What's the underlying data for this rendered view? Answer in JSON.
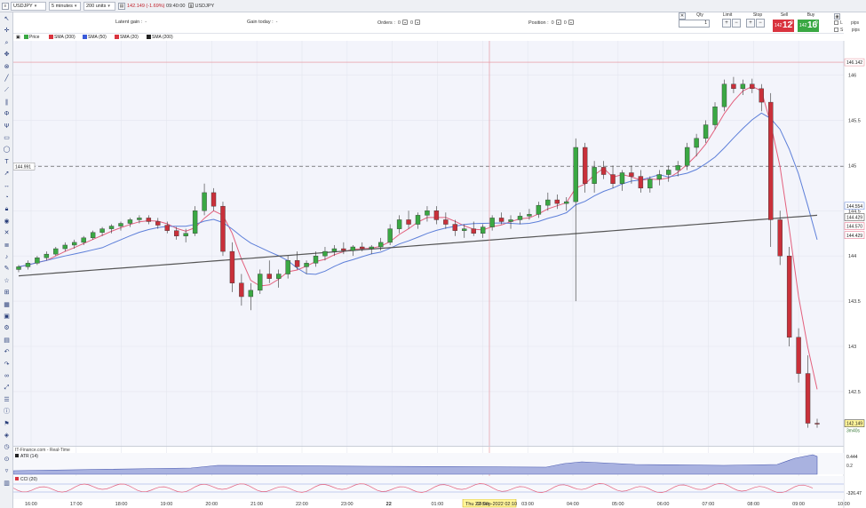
{
  "toolbar": {
    "instrument": "USDJPY",
    "timeframe": "5 minutes",
    "size": "200 units",
    "price_text": "142.149",
    "change_text": "(-1.69%)",
    "time_text": "09:40:00",
    "symbol": "USDJPY"
  },
  "info": {
    "latent_gain_label": "Latent gain :",
    "latent_gain_value": "-",
    "gain_today_label": "Gain today :",
    "gain_today_value": "-",
    "orders_label": "Orders :",
    "orders_value1": "0",
    "orders_value2": "0",
    "position_label": "Position :",
    "position_value1": "0",
    "position_value2": "0"
  },
  "ticket": {
    "qty_label": "Qty",
    "qty_value": "1",
    "limit_label": "Limit",
    "stop_label": "Stop",
    "sell_label": "Sell",
    "buy_label": "Buy",
    "sell_price_small": "142",
    "sell_price_big": "12",
    "sell_price_sup": "9",
    "buy_price_small": "142",
    "buy_price_big": "16",
    "buy_price_sup": "9",
    "pips_label_1": "pips",
    "pips_label_2": "pips",
    "row1_letter": "L",
    "row2_letter": "S"
  },
  "legend": [
    {
      "label": "Price",
      "color": "#3aa843"
    },
    {
      "label": "SMA (200)",
      "color": "#d9343f"
    },
    {
      "label": "SMA (50)",
      "color": "#3a5bd9"
    },
    {
      "label": "SMA (20)",
      "color": "#d9343f"
    },
    {
      "label": "SMA (200)",
      "color": "#222222"
    }
  ],
  "panes": {
    "source_label": "IT-Finance.com - Real-Time",
    "atr_label": "ATR (14)",
    "cci_label": "CCI (20)"
  },
  "colors": {
    "bull": "#3aa843",
    "bear": "#c9303a",
    "sma_pink": "#e3607d",
    "sma_blue": "#5d7fd9",
    "sma_dark": "#555555",
    "grid": "#e4e6ef",
    "bg": "#f3f4fb"
  },
  "chart_data": {
    "type": "candlestick",
    "instrument": "USDJPY",
    "timeframe": "5 minutes",
    "x_labels": [
      "16:00",
      "17:00",
      "18:00",
      "19:00",
      "20:00",
      "21:00",
      "22:00",
      "23:00",
      "22",
      "01:00",
      "02:00",
      "03:00",
      "04:00",
      "05:00",
      "06:00",
      "07:00",
      "08:00",
      "09:00",
      "10:00"
    ],
    "crosshair_label": "Thu 22-Sep-2022 02:10",
    "y_ticks": [
      146,
      145.5,
      145,
      144.5,
      144,
      143.5,
      143,
      142.5
    ],
    "ylim": [
      141.9,
      146.3
    ],
    "price_labels": {
      "top": "146.142",
      "dashed_level": "144.991",
      "sma20": "144.554",
      "sma50": "144.570",
      "sma200a": "144.429",
      "sma200b": "144.429",
      "last": "142.149",
      "countdown": "3m40s"
    },
    "hlines": {
      "top": 146.142,
      "dashed": 144.991
    },
    "ohlc_path": [
      [
        143.85,
        143.9,
        143.82,
        143.88
      ],
      [
        143.88,
        143.95,
        143.85,
        143.92
      ],
      [
        143.92,
        144.0,
        143.9,
        143.98
      ],
      [
        143.98,
        144.05,
        143.95,
        144.02
      ],
      [
        144.02,
        144.1,
        144.0,
        144.08
      ],
      [
        144.08,
        144.15,
        144.05,
        144.12
      ],
      [
        144.12,
        144.18,
        144.08,
        144.15
      ],
      [
        144.15,
        144.22,
        144.12,
        144.2
      ],
      [
        144.2,
        144.28,
        144.18,
        144.26
      ],
      [
        144.26,
        144.32,
        144.22,
        144.3
      ],
      [
        144.3,
        144.35,
        144.25,
        144.33
      ],
      [
        144.33,
        144.38,
        144.28,
        144.36
      ],
      [
        144.36,
        144.42,
        144.32,
        144.4
      ],
      [
        144.4,
        144.45,
        144.36,
        144.42
      ],
      [
        144.42,
        144.45,
        144.35,
        144.38
      ],
      [
        144.38,
        144.42,
        144.3,
        144.34
      ],
      [
        144.34,
        144.38,
        144.25,
        144.28
      ],
      [
        144.28,
        144.32,
        144.18,
        144.22
      ],
      [
        144.22,
        144.3,
        144.15,
        144.25
      ],
      [
        144.25,
        144.55,
        144.22,
        144.5
      ],
      [
        144.5,
        144.8,
        144.45,
        144.7
      ],
      [
        144.7,
        144.75,
        144.5,
        144.55
      ],
      [
        144.55,
        144.6,
        144.0,
        144.05
      ],
      [
        144.05,
        144.15,
        143.6,
        143.7
      ],
      [
        143.7,
        143.8,
        143.45,
        143.55
      ],
      [
        143.55,
        143.7,
        143.4,
        143.62
      ],
      [
        143.62,
        143.85,
        143.58,
        143.8
      ],
      [
        143.8,
        143.95,
        143.7,
        143.75
      ],
      [
        143.75,
        143.85,
        143.65,
        143.8
      ],
      [
        143.8,
        144.0,
        143.75,
        143.95
      ],
      [
        143.95,
        144.05,
        143.85,
        143.88
      ],
      [
        143.88,
        143.95,
        143.8,
        143.92
      ],
      [
        143.92,
        144.05,
        143.88,
        144.0
      ],
      [
        144.0,
        144.1,
        143.95,
        144.05
      ],
      [
        144.05,
        144.12,
        144.0,
        144.08
      ],
      [
        144.08,
        144.15,
        144.02,
        144.06
      ],
      [
        144.06,
        144.12,
        144.0,
        144.1
      ],
      [
        144.1,
        144.15,
        144.05,
        144.08
      ],
      [
        144.08,
        144.12,
        144.02,
        144.1
      ],
      [
        144.1,
        144.2,
        144.06,
        144.15
      ],
      [
        144.15,
        144.35,
        144.12,
        144.3
      ],
      [
        144.3,
        144.45,
        144.25,
        144.4
      ],
      [
        144.4,
        144.5,
        144.3,
        144.35
      ],
      [
        144.35,
        144.48,
        144.3,
        144.45
      ],
      [
        144.45,
        144.55,
        144.38,
        144.5
      ],
      [
        144.5,
        144.55,
        144.35,
        144.4
      ],
      [
        144.4,
        144.48,
        144.3,
        144.35
      ],
      [
        144.35,
        144.4,
        144.22,
        144.28
      ],
      [
        144.28,
        144.35,
        144.2,
        144.3
      ],
      [
        144.3,
        144.38,
        144.22,
        144.25
      ],
      [
        144.25,
        144.35,
        144.2,
        144.32
      ],
      [
        144.32,
        144.45,
        144.28,
        144.42
      ],
      [
        144.42,
        144.48,
        144.35,
        144.38
      ],
      [
        144.38,
        144.45,
        144.3,
        144.4
      ],
      [
        144.4,
        144.48,
        144.35,
        144.44
      ],
      [
        144.44,
        144.52,
        144.4,
        144.46
      ],
      [
        144.46,
        144.6,
        144.42,
        144.56
      ],
      [
        144.56,
        144.7,
        144.5,
        144.62
      ],
      [
        144.62,
        144.68,
        144.52,
        144.58
      ],
      [
        144.58,
        144.65,
        144.5,
        144.6
      ],
      [
        144.6,
        145.3,
        143.5,
        145.2
      ],
      [
        145.2,
        145.25,
        144.7,
        144.8
      ],
      [
        144.8,
        145.05,
        144.7,
        144.98
      ],
      [
        144.98,
        145.05,
        144.85,
        144.9
      ],
      [
        144.9,
        145.0,
        144.75,
        144.8
      ],
      [
        144.8,
        144.95,
        144.72,
        144.92
      ],
      [
        144.92,
        145.0,
        144.8,
        144.88
      ],
      [
        144.88,
        144.95,
        144.7,
        144.75
      ],
      [
        144.75,
        144.88,
        144.7,
        144.85
      ],
      [
        144.85,
        144.95,
        144.78,
        144.9
      ],
      [
        144.9,
        145.0,
        144.82,
        144.95
      ],
      [
        144.95,
        145.05,
        144.88,
        145.0
      ],
      [
        145.0,
        145.25,
        144.95,
        145.2
      ],
      [
        145.2,
        145.35,
        145.1,
        145.3
      ],
      [
        145.3,
        145.5,
        145.25,
        145.45
      ],
      [
        145.45,
        145.7,
        145.4,
        145.65
      ],
      [
        145.65,
        145.95,
        145.6,
        145.9
      ],
      [
        145.9,
        145.98,
        145.8,
        145.85
      ],
      [
        145.85,
        145.95,
        145.78,
        145.9
      ],
      [
        145.9,
        145.96,
        145.8,
        145.85
      ],
      [
        145.85,
        145.9,
        145.6,
        145.7
      ],
      [
        145.7,
        145.8,
        144.1,
        144.4
      ],
      [
        144.4,
        144.5,
        143.9,
        144.0
      ],
      [
        144.0,
        144.1,
        143.0,
        143.1
      ],
      [
        143.1,
        143.2,
        142.6,
        142.7
      ],
      [
        142.7,
        142.9,
        142.1,
        142.15
      ],
      [
        142.15,
        142.2,
        142.1,
        142.149
      ]
    ]
  }
}
